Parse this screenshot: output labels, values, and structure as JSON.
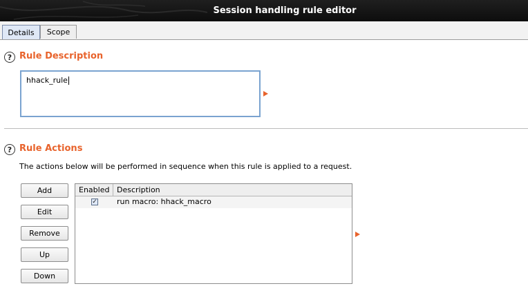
{
  "window": {
    "title": "Session handling rule editor"
  },
  "tabs": [
    {
      "label": "Details",
      "active": true
    },
    {
      "label": "Scope",
      "active": false
    }
  ],
  "rule_description": {
    "heading": "Rule Description",
    "value": "hhack_rule"
  },
  "rule_actions": {
    "heading": "Rule Actions",
    "intro": "The actions below will be performed in sequence when this rule is applied to a request.",
    "buttons": {
      "add": "Add",
      "edit": "Edit",
      "remove": "Remove",
      "up": "Up",
      "down": "Down"
    },
    "table": {
      "columns": [
        "Enabled",
        "Description"
      ],
      "rows": [
        {
          "enabled": true,
          "description": "run macro: hhack_macro"
        }
      ]
    }
  },
  "icons": {
    "help": "question-mark-help-icon",
    "expand": "orange-triangle-arrow-icon",
    "check": "checkmark-icon"
  },
  "colors": {
    "accent": "#e8632c",
    "titlebar": "#111111",
    "focus_border": "#7aa3d0"
  }
}
